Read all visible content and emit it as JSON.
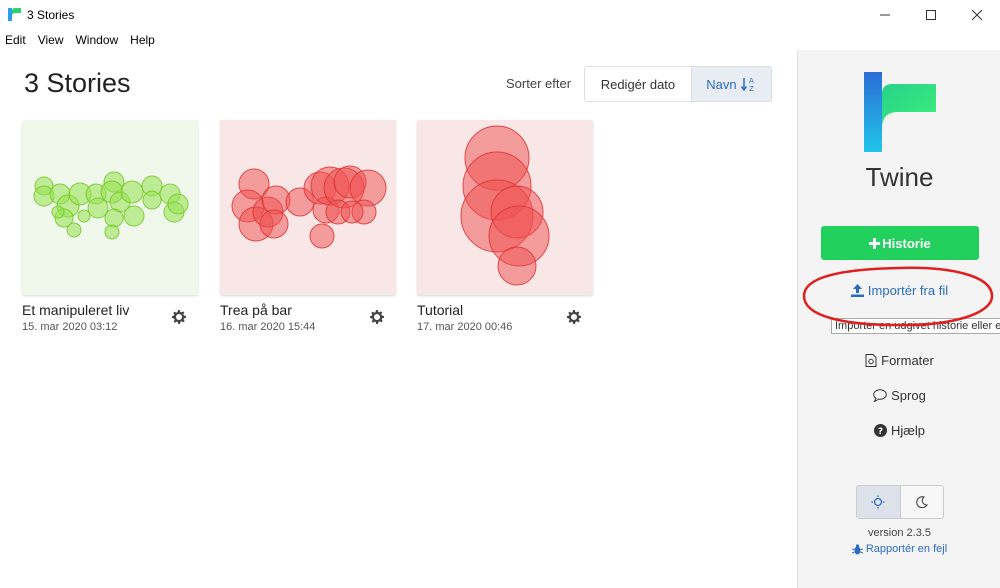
{
  "window": {
    "title": "3 Stories"
  },
  "menu": [
    "Edit",
    "View",
    "Window",
    "Help"
  ],
  "main": {
    "title": "3 Stories",
    "sort": {
      "label": "Sorter efter",
      "date_label": "Redigér dato",
      "name_label": "Navn"
    }
  },
  "stories": [
    {
      "name": "Et manipuleret liv",
      "date": "15. mar 2020 03:12",
      "theme": "green"
    },
    {
      "name": "Trea på bar",
      "date": "16. mar 2020 15:44",
      "theme": "red"
    },
    {
      "name": "Tutorial",
      "date": "17. mar 2020 00:46",
      "theme": "red"
    }
  ],
  "sidebar": {
    "brand": "Twine",
    "new_story": "Historie",
    "import": "Importér fra fil",
    "import_tooltip": "Importer en udgivet historie eller et arkiv",
    "formats": "Formater",
    "language": "Sprog",
    "help": "Hjælp",
    "version": "version 2.3.5",
    "report": "Rapportér en fejl"
  },
  "colors": {
    "accent": "#22d05e",
    "link": "#2a6bbf",
    "annotation": "#e02020",
    "thumb_green_bg": "#f0f8ec",
    "thumb_red_bg": "#f9e6e6"
  },
  "icons": {
    "app": "twine-logo-icon",
    "gear": "gear-icon",
    "plus": "plus-icon",
    "upload": "upload-icon",
    "formats": "document-icon",
    "language": "speech-bubble-icon",
    "help": "question-circle-icon",
    "light": "sun-icon",
    "dark": "moon-icon",
    "bug": "bug-icon",
    "sort": "sort-alpha-icon"
  }
}
